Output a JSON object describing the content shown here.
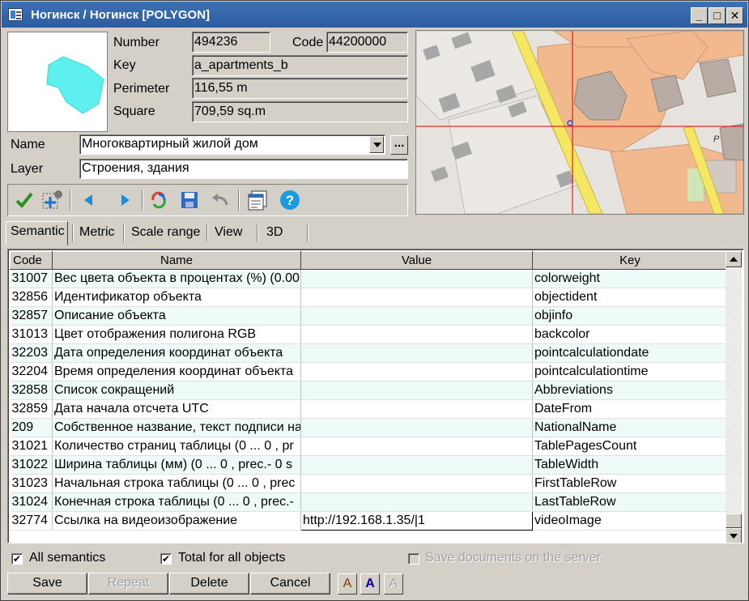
{
  "window": {
    "title": "Ногинск / Ногинск [POLYGON]"
  },
  "info": {
    "number_label": "Number",
    "number_value": "494236",
    "code_label": "Code",
    "code_value": "44200000",
    "key_label": "Key",
    "key_value": "a_apartments_b",
    "perimeter_label": "Perimeter",
    "perimeter_value": "116,55 m",
    "square_label": "Square",
    "square_value": "709,59 sq.m",
    "name_label": "Name",
    "name_value": "Многоквартирный жилой дом",
    "layer_label": "Layer",
    "layer_value": "Строения, здания",
    "ellipsis": "..."
  },
  "toolbar": {
    "icons": [
      "check-icon",
      "add-point-icon",
      "arrow-left-icon",
      "arrow-right-icon",
      "refresh-icon",
      "save-icon",
      "undo-icon",
      "properties-icon",
      "help-icon"
    ]
  },
  "tabs": [
    {
      "label": "Semantic",
      "active": true
    },
    {
      "label": "Metric"
    },
    {
      "label": "Scale range"
    },
    {
      "label": "View"
    },
    {
      "label": "3D"
    }
  ],
  "grid": {
    "columns": [
      "Code",
      "Name",
      "Value",
      "Key"
    ],
    "rows": [
      {
        "code": "31007",
        "name": "Вес цвета объекта в процентах (%)  (0.00",
        "value": "",
        "key": "colorweight"
      },
      {
        "code": "32856",
        "name": "Идентификатор объекта",
        "value": "",
        "key": "objectident"
      },
      {
        "code": "32857",
        "name": "Описание объекта",
        "value": "",
        "key": "objinfo"
      },
      {
        "code": "31013",
        "name": "Цвет отображения полигона RGB",
        "value": "",
        "key": "backcolor"
      },
      {
        "code": "32203",
        "name": "Дата определения координат объекта",
        "value": "",
        "key": "pointcalculationdate"
      },
      {
        "code": "32204",
        "name": "Время определения координат объекта",
        "value": "",
        "key": "pointcalculationtime"
      },
      {
        "code": "32858",
        "name": "Список сокращений",
        "value": "",
        "key": "Abbreviations"
      },
      {
        "code": "32859",
        "name": "Дата начала отсчета UTC",
        "value": "",
        "key": "DateFrom"
      },
      {
        "code": "209",
        "name": "Собственное название, текст подписи на",
        "value": "",
        "key": "NationalName"
      },
      {
        "code": "31021",
        "name": "Количество страниц таблицы  (0 ... 0 , pr",
        "value": "",
        "key": "TablePagesCount"
      },
      {
        "code": "31022",
        "name": "Ширина таблицы (мм)  (0 ... 0 , prec.- 0  s",
        "value": "",
        "key": "TableWidth"
      },
      {
        "code": "31023",
        "name": "Начальная строка таблицы  (0 ... 0 , prec",
        "value": "",
        "key": "FirstTableRow"
      },
      {
        "code": "31024",
        "name": "Конечная строка таблицы  (0 ... 0 , prec.-",
        "value": "",
        "key": "LastTableRow"
      },
      {
        "code": "32774",
        "name": "Ссылка на видеоизображение",
        "value": "http://192.168.1.35/|1",
        "key": "videoImage"
      }
    ]
  },
  "options": {
    "all_semantics": {
      "label": "All semantics",
      "checked": true
    },
    "total_all_objects": {
      "label": "Total for all objects",
      "checked": true
    },
    "save_documents": {
      "label": "Save documents on the server",
      "checked": false,
      "disabled": true
    }
  },
  "buttons": {
    "save": "Save",
    "repeat": "Repeat",
    "delete": "Delete",
    "cancel": "Cancel",
    "font_a1": "A",
    "font_a2": "A",
    "font_a3": "A"
  },
  "colors": {
    "title_bar": "#2f62a6",
    "row_alt": "#eefaf8",
    "map_building": "#f2b98f",
    "map_road": "#f5e663",
    "crosshair": "#e00000"
  }
}
